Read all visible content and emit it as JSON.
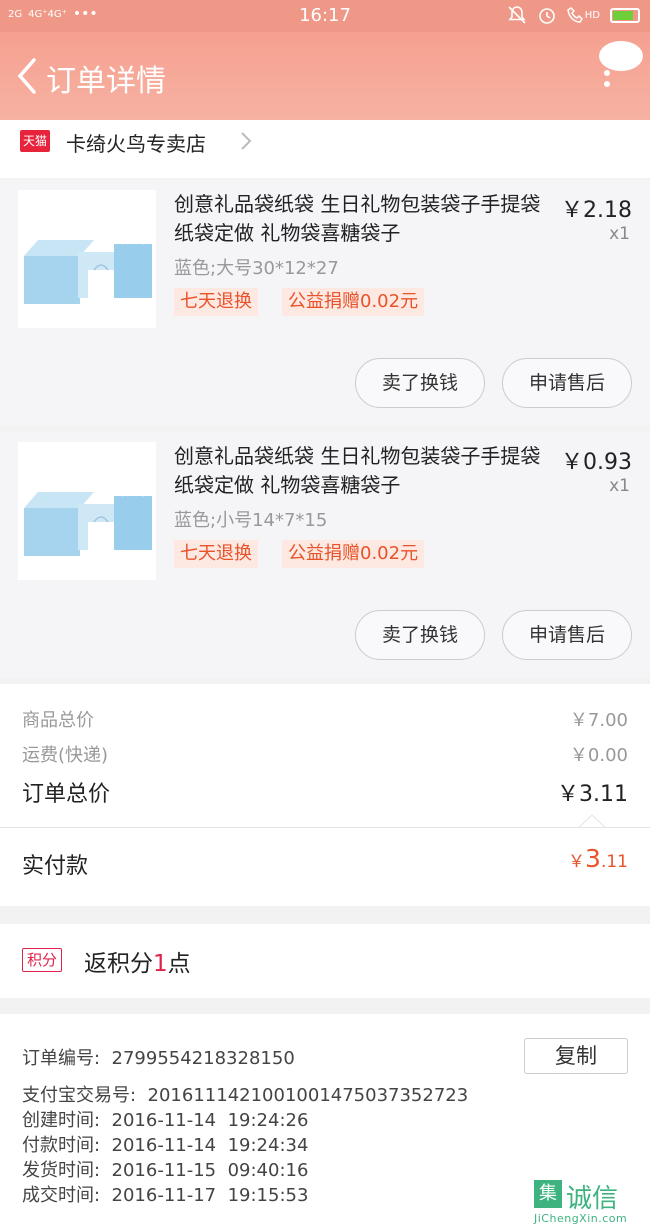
{
  "status_bar": {
    "signal_left": "2G",
    "network": "4G⁺4G⁺",
    "dots": "•••",
    "time": "16:17",
    "hd": "HD",
    "icons": [
      "mute-bell-icon",
      "alarm-icon",
      "phone-hd-icon",
      "battery-icon"
    ]
  },
  "header": {
    "title": "订单详情",
    "back_icon": "chevron-left-icon",
    "menu_icon": "chat-bubble-icon"
  },
  "store": {
    "badge": "天猫",
    "name": "卡绮火鸟专卖店"
  },
  "items": [
    {
      "title": "创意礼品袋纸袋 生日礼物包装袋子手提袋纸袋定做 礼物袋喜糖袋子",
      "price": "￥2.18",
      "qty": "x1",
      "sku": "蓝色;大号30*12*27",
      "tags": [
        "七天退换",
        "公益捐赠0.02元"
      ],
      "buttons": [
        "卖了换钱",
        "申请售后"
      ]
    },
    {
      "title": "创意礼品袋纸袋 生日礼物包装袋子手提袋纸袋定做 礼物袋喜糖袋子",
      "price": "￥0.93",
      "qty": "x1",
      "sku": "蓝色;小号14*7*15",
      "tags": [
        "七天退换",
        "公益捐赠0.02元"
      ],
      "buttons": [
        "卖了换钱",
        "申请售后"
      ]
    }
  ],
  "summary": {
    "goods_label": "商品总价",
    "goods_value": "￥7.00",
    "shipping_label": "运费(快递)",
    "shipping_value": "￥0.00",
    "order_total_label": "订单总价",
    "order_total_value": "￥3.11",
    "paid_label": "实付款",
    "paid_currency": "￥",
    "paid_int": "3",
    "paid_dec": ".11"
  },
  "points": {
    "badge": "积分",
    "text_prefix": "返积分",
    "count": "1",
    "text_suffix": "点"
  },
  "order_info": {
    "order_no_label": "订单编号:",
    "order_no": "2799554218328150",
    "copy_label": "复制",
    "alipay_label": "支付宝交易号:",
    "alipay_no": "2016111421001001475037352723",
    "created_label": "创建时间:",
    "created": "2016-11-14  19:24:26",
    "paid_label": "付款时间:",
    "paid": "2016-11-14  19:24:34",
    "shipped_label": "发货时间:",
    "shipped": "2016-11-15  09:40:16",
    "completed_label": "成交时间:",
    "completed": "2016-11-17  19:15:53"
  },
  "watermark": {
    "box": "集",
    "text": "诚信",
    "sub": "JiChengXin.com"
  },
  "colors": {
    "header": "#f5a090",
    "accent_red": "#e0224a",
    "price_orange": "#e8532a"
  }
}
